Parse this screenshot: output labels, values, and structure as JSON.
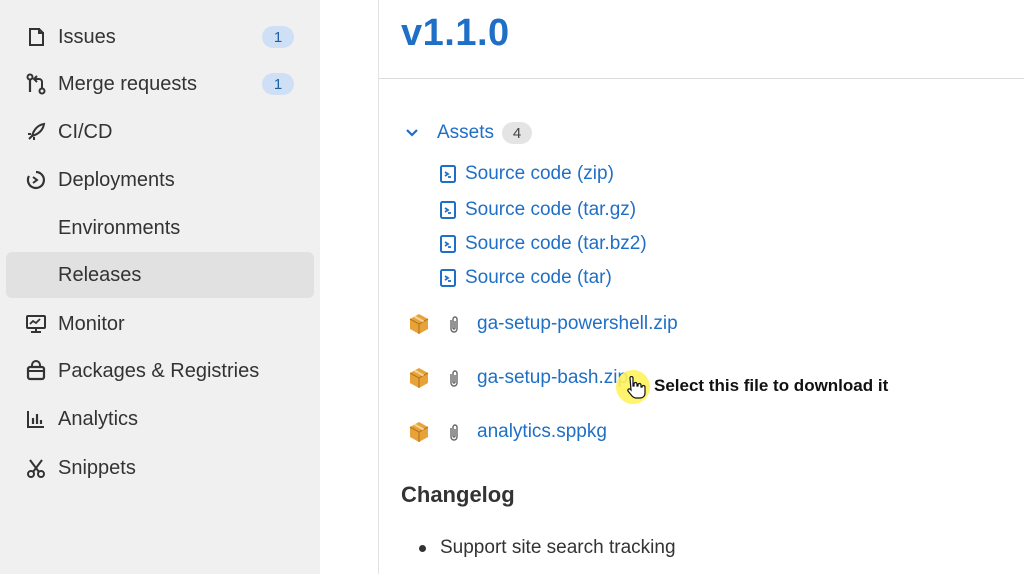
{
  "sidebar": {
    "items": [
      {
        "label": "Issues",
        "icon": "issues-icon",
        "badge": "1"
      },
      {
        "label": "Merge requests",
        "icon": "merge-request-icon",
        "badge": "1"
      },
      {
        "label": "CI/CD",
        "icon": "rocket-icon"
      },
      {
        "label": "Deployments",
        "icon": "deployments-icon"
      },
      {
        "label": "Environments"
      },
      {
        "label": "Releases",
        "active": true
      },
      {
        "label": "Monitor",
        "icon": "monitor-icon"
      },
      {
        "label": "Packages & Registries",
        "icon": "package-icon"
      },
      {
        "label": "Analytics",
        "icon": "chart-icon"
      },
      {
        "label": "Snippets",
        "icon": "scissors-icon"
      }
    ]
  },
  "release": {
    "title": "v1.1.0",
    "assets_label": "Assets",
    "assets_count": "4",
    "source_links": [
      "Source code (zip)",
      "Source code (tar.gz)",
      "Source code (tar.bz2)",
      "Source code (tar)"
    ],
    "files": [
      "ga-setup-powershell.zip",
      "ga-setup-bash.zip",
      "analytics.sppkg"
    ],
    "changelog_title": "Changelog",
    "changelog_items": [
      "Support site search tracking"
    ]
  },
  "annotation": {
    "callout": "Select this file to download it"
  },
  "colors": {
    "link": "#1f6fc7",
    "sidebar_bg": "#f0f0f0",
    "active_bg": "#e1e1e1",
    "badge_bg": "#cfe0f6",
    "highlight": "#fff35c"
  }
}
